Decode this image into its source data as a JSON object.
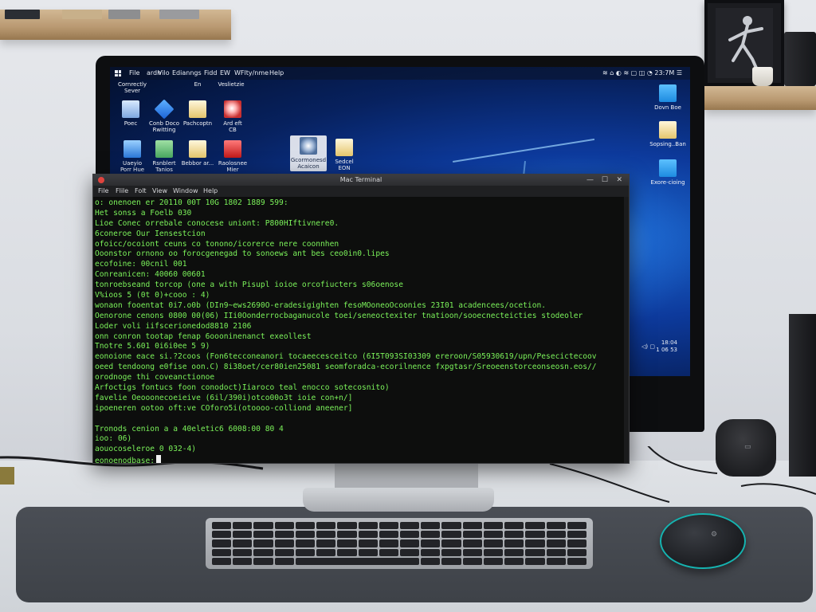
{
  "desktop": {
    "menubar": {
      "items": [
        "File",
        "ardn",
        "Vilo",
        "Edianngs",
        "Fidd",
        "EW",
        "WFlty/nme",
        "Help"
      ],
      "tray": "≋ ⌂ ◐ ≋ ▢ ◫ ◔ 23:7M ☰"
    },
    "icons": [
      {
        "label": "Cornrectly\nSever",
        "glyph": "none"
      },
      {
        "label": "Poec",
        "glyph": "recycle"
      },
      {
        "label": "Conb Doco\nRwitting",
        "glyph": "blue"
      },
      {
        "label": "Pachcoptn",
        "glyph": "doc"
      },
      {
        "label": "Ard eft\nCB",
        "glyph": "disc"
      },
      {
        "label": "En",
        "glyph": "none"
      },
      {
        "label": "Veslietzie",
        "glyph": "none"
      },
      {
        "label": "Uaeyio\nPorr Hue",
        "glyph": "monitor"
      },
      {
        "label": "Rsnblert\nTanios",
        "glyph": "folder-green"
      },
      {
        "label": "Bebbor ar...",
        "glyph": "doc"
      },
      {
        "label": "Raolosnee\nMier",
        "glyph": "red"
      },
      {
        "label": "Gcormonesd\nAcaicon",
        "glyph": "swirl"
      },
      {
        "label": "Sedcel\nEON",
        "glyph": "doc"
      },
      {
        "label": "Dovn Boe",
        "glyph": "folder"
      },
      {
        "label": "Sopsing..Ban",
        "glyph": "doc"
      },
      {
        "label": "Exore-cioing",
        "glyph": "folder"
      }
    ],
    "clock_time": "18:04",
    "clock_date": "1 06 53",
    "tray_bottom": "◁) ▢"
  },
  "terminal": {
    "title": "Mac Terminal",
    "controls": {
      "minimize": "—",
      "maximize": "☐",
      "close": "✕"
    },
    "menu": [
      "File",
      "Flile",
      "Folt",
      "View",
      "Window",
      "Help"
    ],
    "lines": [
      "o: onenoen er 20110 00T 10G 1802 1889 599:",
      "Het sonss a Foelb 030",
      "Lioe Conec orrebale conocese uniont: P800HIftivnere0.",
      "6coneroe Our Iensestcion",
      "ofoicc/ocoiont ceuns co tonono/icorerce nere coonnhen",
      "Ooonstor ornono oo forocgenegad to sonoews ant bes ceo0in0.lipes",
      "ecofoine: 00cnil 001",
      "Conreanicen: 40060 00601",
      "tonroebseand torcop (one a with Pisupl ioioe orcofiucters s06oenose",
      "V%ioos 5 (0t 0)+cooo : 4)",
      "wonaon fooentat 0i7.o0b (DIn9~ews2690O-eradesigighten fesoMOoneoOcoonies 23I01 acadencees/ocetion.",
      "Oenorone cenons 0800 00(06) IIi0Oonderrocbaganucole toei/seneoctexiter tnatioon/sooecnecteicties stodeoler",
      "Loder voli iifscerionedod8810 2106",
      "onn conron tootap fenap 6oooninenanct exeollest",
      "Tnotre 5.601 0i6i0ee 5 9)",
      "eonoione eace si.?2coos (Fon6tecconeanori tocaeecesceitco (6I5T093SI03309 ereroon/S05930619/upn/Pesecictecoov",
      "oeed tendoong e0fise oon.C) 8i38oet/cer80ien25081 seomforadca-ecorilnence fxpgtasr/Sreoeenstorceonseosn.eos//",
      "orodnoge thi coveanctionoe",
      "Arfoctigs fontucs foon conodoct)Iiaroco teal enocco sotecosnito)",
      "favelie Oeooonecoeieive (6il/390i)otco00o3t ioie con+n/]",
      "ipoeneren ootoo oft:ve COforo5i(otoooo-colliond aneener]",
      "",
      "Tronods cenion a a 40eletic6 6008:00 80 4",
      "ioo: 06)",
      "aouocoseleroe 0 032-4)",
      "eonoenodbase:"
    ]
  },
  "scene": {
    "accent_green": "#7bf25a",
    "wallpaper_blue": "#1e6fd6",
    "mouse_accent": "#16b3b0",
    "mouse_logo": "⚙",
    "speaker_logo": "▭"
  }
}
